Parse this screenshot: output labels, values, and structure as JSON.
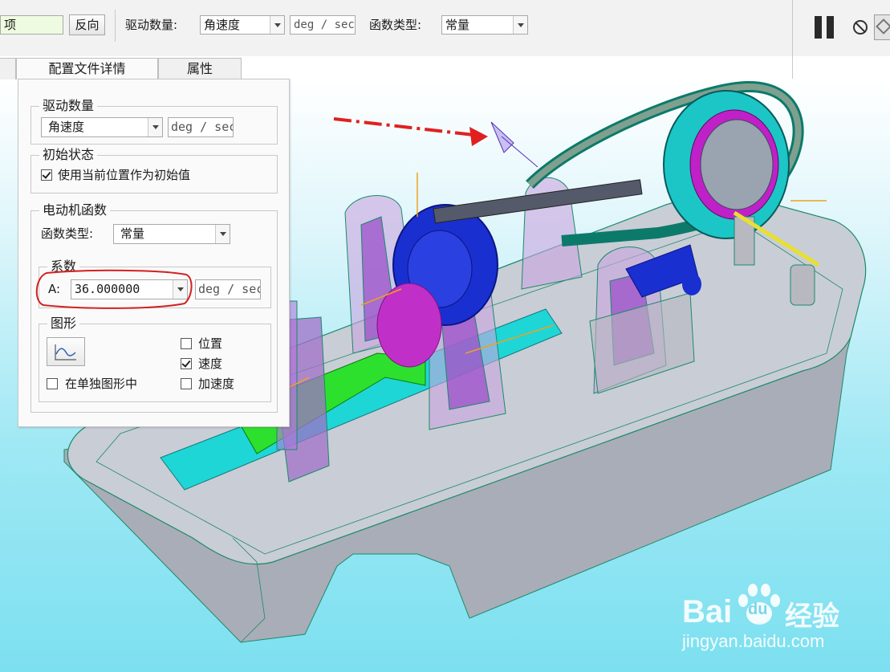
{
  "toolbar": {
    "clipped_field_text": "项",
    "reverse_button": "反向",
    "drive_quantity_label": "驱动数量:",
    "drive_quantity_value": "角速度",
    "unit_value": "deg / sec",
    "function_type_label": "函数类型:",
    "function_type_value": "常量"
  },
  "tabs": [
    {
      "label": ""
    },
    {
      "label": "配置文件详情"
    },
    {
      "label": "属性"
    }
  ],
  "panel": {
    "drive_quantity": {
      "title": "驱动数量",
      "value": "角速度",
      "unit": "deg / sec"
    },
    "initial_state": {
      "title": "初始状态",
      "checkbox_label": "使用当前位置作为初始值",
      "checked": true
    },
    "motor_function": {
      "title": "电动机函数",
      "function_type_label": "函数类型:",
      "function_type_value": "常量",
      "coefficients": {
        "title": "系数",
        "a_label": "A:",
        "a_value": "36.000000",
        "unit": "deg / sec"
      }
    },
    "graph": {
      "title": "图形",
      "separate_graph_label": "在单独图形中",
      "separate_graph_checked": false,
      "position_label": "位置",
      "position_checked": false,
      "velocity_label": "速度",
      "velocity_checked": true,
      "acceleration_label": "加速度",
      "acceleration_checked": false
    }
  },
  "watermark": {
    "logo_text": "Bai",
    "logo_text_2": "du",
    "brand_suffix": "经验",
    "url": "jingyan.baidu.com"
  },
  "colors": {
    "highlight_ellipse": "#d42020",
    "annotation_arrow": "#e02020",
    "base_plate": "#c8ccd6",
    "gear": "#1a2fd0",
    "flywheel_rim": "#22c3c3",
    "support_fill": "#9a5ac0"
  }
}
